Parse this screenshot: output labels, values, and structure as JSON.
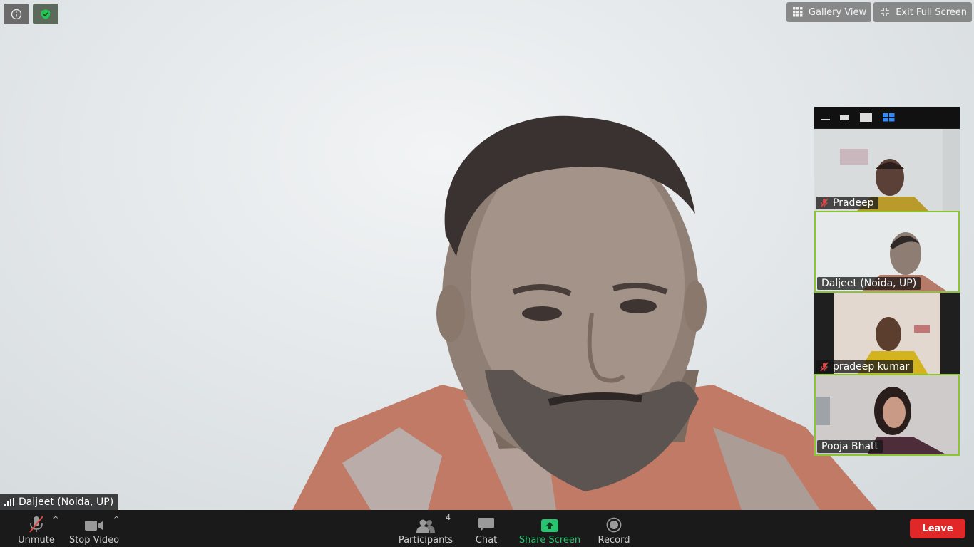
{
  "top_right": {
    "gallery_view": "Gallery View",
    "exit_full_screen": "Exit Full Screen"
  },
  "speaker": {
    "name": "Daljeet (Noida, UP)"
  },
  "participants_strip": [
    {
      "name": "Pradeep",
      "muted": true
    },
    {
      "name": "Daljeet (Noida, UP)",
      "muted": false,
      "active": true
    },
    {
      "name": "pradeep kumar",
      "muted": true
    },
    {
      "name": "Pooja Bhatt",
      "muted": false,
      "active": true
    }
  ],
  "toolbar": {
    "unmute": "Unmute",
    "stop_video": "Stop Video",
    "participants": "Participants",
    "participants_count": "4",
    "chat": "Chat",
    "share_screen": "Share Screen",
    "record": "Record",
    "leave": "Leave"
  },
  "colors": {
    "active_border": "#8ac632",
    "share_green": "#27c46f",
    "leave_red": "#e02828",
    "mute_red": "#e04848"
  }
}
